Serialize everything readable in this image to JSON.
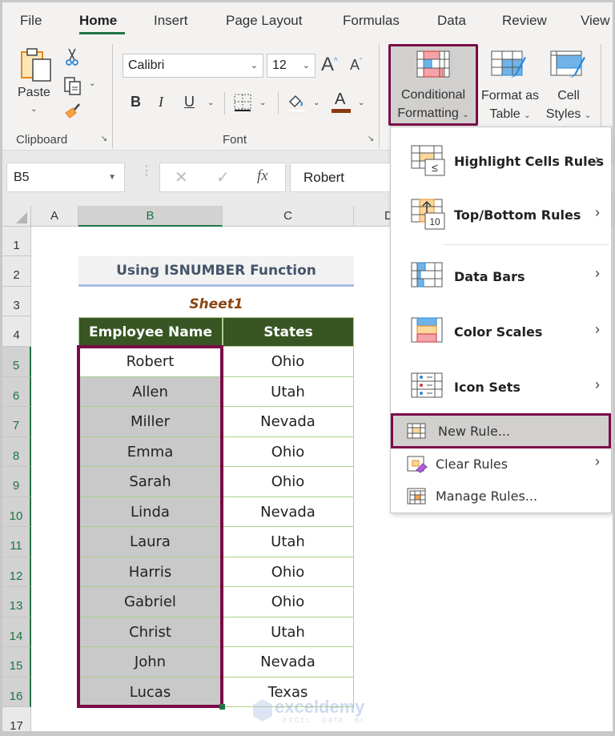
{
  "tabs": [
    {
      "label": "File",
      "active": false
    },
    {
      "label": "Home",
      "active": true
    },
    {
      "label": "Insert",
      "active": false
    },
    {
      "label": "Page Layout",
      "active": false
    },
    {
      "label": "Formulas",
      "active": false
    },
    {
      "label": "Data",
      "active": false
    },
    {
      "label": "Review",
      "active": false
    },
    {
      "label": "View",
      "active": false
    }
  ],
  "ribbon": {
    "clipboard": {
      "label": "Clipboard",
      "paste_label": "Paste"
    },
    "font": {
      "label": "Font",
      "font_name": "Calibri",
      "font_size": "12",
      "bold": "B",
      "italic": "I",
      "underline": "U",
      "grow": "A",
      "shrink": "A",
      "font_color_glyph": "A",
      "fill_color": "#ffffff",
      "font_color": "#8b3a0f"
    },
    "styles": {
      "conditional_formatting": [
        "Conditional",
        "Formatting"
      ],
      "format_as_table": [
        "Format as",
        "Table"
      ],
      "cell_styles": [
        "Cell",
        "Styles"
      ]
    }
  },
  "formula_bar": {
    "name_box": "B5",
    "cancel": "✕",
    "enter": "✓",
    "fx": "fx",
    "value": "Robert"
  },
  "grid": {
    "columns": [
      "A",
      "B",
      "C",
      "D"
    ],
    "selected_column": "B",
    "rows": [
      "1",
      "2",
      "3",
      "4",
      "5",
      "6",
      "7",
      "8",
      "9",
      "10",
      "11",
      "12",
      "13",
      "14",
      "15",
      "16",
      "17"
    ],
    "title": "Using ISNUMBER Function",
    "sheet_label": "Sheet1",
    "headers": [
      "Employee Name",
      "States"
    ],
    "data": [
      [
        "Robert",
        "Ohio"
      ],
      [
        "Allen",
        "Utah"
      ],
      [
        "Miller",
        "Nevada"
      ],
      [
        "Emma",
        "Ohio"
      ],
      [
        "Sarah",
        "Ohio"
      ],
      [
        "Linda",
        "Nevada"
      ],
      [
        "Laura",
        "Utah"
      ],
      [
        "Harris",
        "Ohio"
      ],
      [
        "Gabriel",
        "Ohio"
      ],
      [
        "Christ",
        "Utah"
      ],
      [
        "John",
        "Nevada"
      ],
      [
        "Lucas",
        "Texas"
      ]
    ]
  },
  "menu": {
    "items": [
      {
        "label": "Highlight Cells Rules",
        "icon": "highlight-cells-icon",
        "submenu": true
      },
      {
        "label": "Top/Bottom Rules",
        "icon": "top-bottom-icon",
        "submenu": true
      },
      {
        "label": "Data Bars",
        "icon": "data-bars-icon",
        "submenu": true
      },
      {
        "label": "Color Scales",
        "icon": "color-scales-icon",
        "submenu": true
      },
      {
        "label": "Icon Sets",
        "icon": "icon-sets-icon",
        "submenu": true
      },
      {
        "label": "New Rule...",
        "icon": "new-rule-icon",
        "submenu": false,
        "highlighted": true
      },
      {
        "label": "Clear Rules",
        "icon": "clear-rules-icon",
        "submenu": true
      },
      {
        "label": "Manage Rules...",
        "icon": "manage-rules-icon",
        "submenu": false
      }
    ]
  },
  "watermark": {
    "brand": "exceldemy",
    "tagline": "EXCEL · DATA · BI"
  },
  "colors": {
    "accent_green": "#217346",
    "header_fill": "#375623",
    "highlight_border": "#7a0b48",
    "selection_fill": "#c9c9c9"
  }
}
